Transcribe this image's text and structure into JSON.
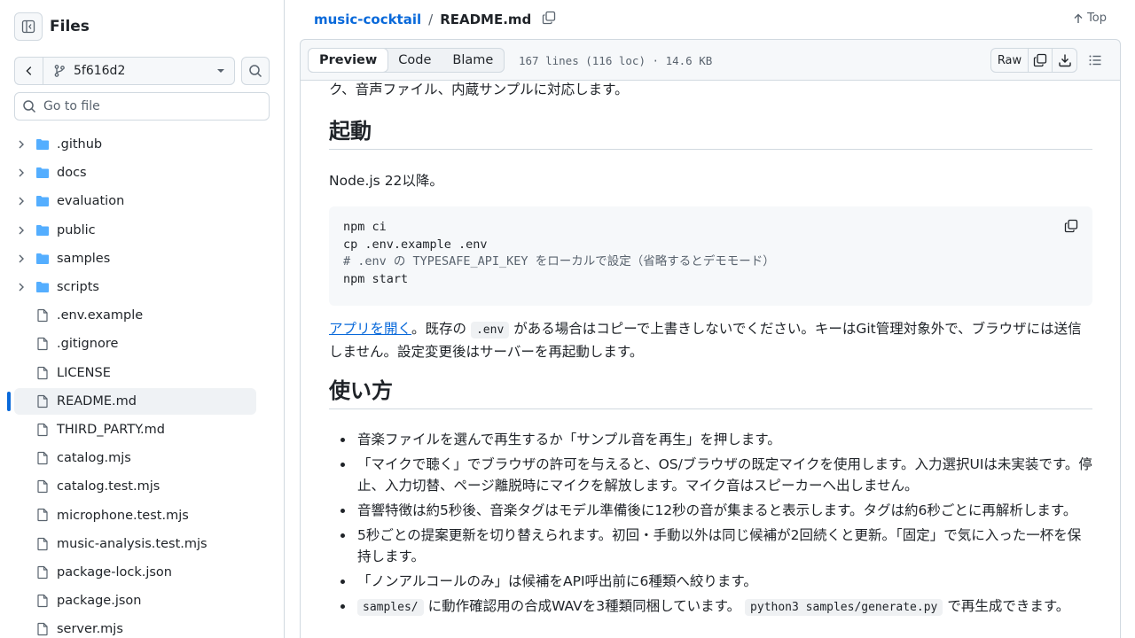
{
  "sidebar": {
    "title": "Files",
    "branch": "5f616d2",
    "goto_placeholder": "Go to file",
    "tree": [
      {
        "name": ".github",
        "type": "folder"
      },
      {
        "name": "docs",
        "type": "folder"
      },
      {
        "name": "evaluation",
        "type": "folder"
      },
      {
        "name": "public",
        "type": "folder"
      },
      {
        "name": "samples",
        "type": "folder"
      },
      {
        "name": "scripts",
        "type": "folder"
      },
      {
        "name": ".env.example",
        "type": "file"
      },
      {
        "name": ".gitignore",
        "type": "file"
      },
      {
        "name": "LICENSE",
        "type": "file"
      },
      {
        "name": "README.md",
        "type": "file",
        "selected": true
      },
      {
        "name": "THIRD_PARTY.md",
        "type": "file"
      },
      {
        "name": "catalog.mjs",
        "type": "file"
      },
      {
        "name": "catalog.test.mjs",
        "type": "file"
      },
      {
        "name": "microphone.test.mjs",
        "type": "file"
      },
      {
        "name": "music-analysis.test.mjs",
        "type": "file"
      },
      {
        "name": "package-lock.json",
        "type": "file"
      },
      {
        "name": "package.json",
        "type": "file"
      },
      {
        "name": "server.mjs",
        "type": "file"
      }
    ]
  },
  "header": {
    "repo": "music-cocktail",
    "sep": "/",
    "file": "README.md",
    "top_label": "Top"
  },
  "filebar": {
    "tabs": [
      "Preview",
      "Code",
      "Blame"
    ],
    "active_tab": "Preview",
    "info": "167 lines (116 loc) · 14.6 KB",
    "raw_label": "Raw"
  },
  "readme": {
    "top_line": "ク、音声ファイル、内蔵サンプルに対応します。",
    "h_start": "起動",
    "node_req": "Node.js 22以降。",
    "code": [
      "npm ci",
      "cp .env.example .env",
      "# .env の TYPESAFE_API_KEY をローカルで設定（省略するとデモモード）",
      "npm start"
    ],
    "open_link": "アプリを開く",
    "open_after": "。既存の",
    "env_code": ".env",
    "open_rest": "がある場合はコピーで上書きしないでください。キーはGit管理対象外で、ブラウザには送信しません。設定変更後はサーバーを再起動します。",
    "h_usage": "使い方",
    "items": [
      "音楽ファイルを選んで再生するか「サンプル音を再生」を押します。",
      "「マイクで聴く」でブラウザの許可を与えると、OS/ブラウザの既定マイクを使用します。入力選択UIは未実装です。停止、入力切替、ページ離脱時にマイクを解放します。マイク音はスピーカーへ出しません。",
      "音響特徴は約5秒後、音楽タグはモデル準備後に12秒の音が集まると表示します。タグは約6秒ごとに再解析します。",
      "5秒ごとの提案更新を切り替えられます。初回・手動以外は同じ候補が2回続くと更新。「固定」で気に入った一杯を保持します。",
      "「ノンアルコールのみ」は候補をAPI呼出前に6種類へ絞ります。"
    ],
    "last_item": {
      "code1": "samples/",
      "text1": "に動作確認用の合成WAVを3種類同梱しています。",
      "code2": "python3 samples/generate.py",
      "text2": "で再生成できます。"
    }
  }
}
